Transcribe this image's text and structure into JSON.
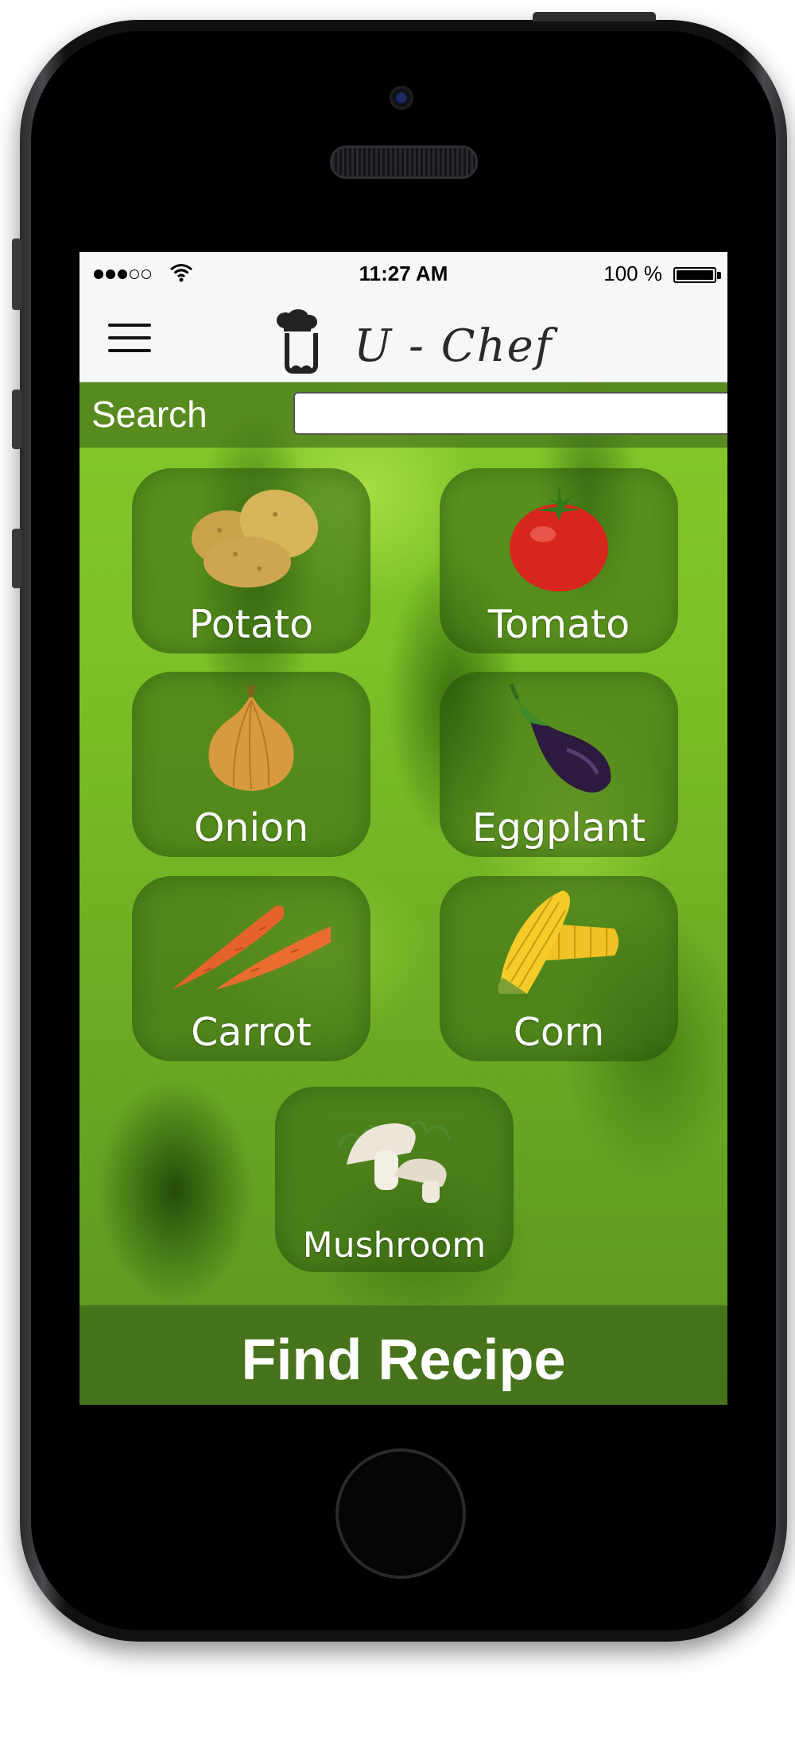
{
  "status_bar": {
    "signal_dots_filled": 3,
    "signal_dots_total": 5,
    "time": "11:27 AM",
    "battery_text": "100 %",
    "battery_level": 1.0
  },
  "nav": {
    "menu_icon": "hamburger-menu-icon",
    "logo_icon": "chef-logo-icon",
    "title": "U - Chef"
  },
  "search": {
    "label": "Search",
    "value": "",
    "placeholder": ""
  },
  "vegetables": [
    {
      "label": "Potato",
      "icon": "potato-icon"
    },
    {
      "label": "Tomato",
      "icon": "tomato-icon"
    },
    {
      "label": "Onion",
      "icon": "onion-icon"
    },
    {
      "label": "Eggplant",
      "icon": "eggplant-icon"
    },
    {
      "label": "Carrot",
      "icon": "carrot-icon"
    },
    {
      "label": "Corn",
      "icon": "corn-icon"
    },
    {
      "label": "Mushroom",
      "icon": "mushroom-icon"
    }
  ],
  "action": {
    "find_recipe_label": "Find Recipe"
  },
  "colors": {
    "screen_green": "#7cc127",
    "tile_overlay": "#37641499",
    "status_bar_bg": "#f7f7f7"
  }
}
